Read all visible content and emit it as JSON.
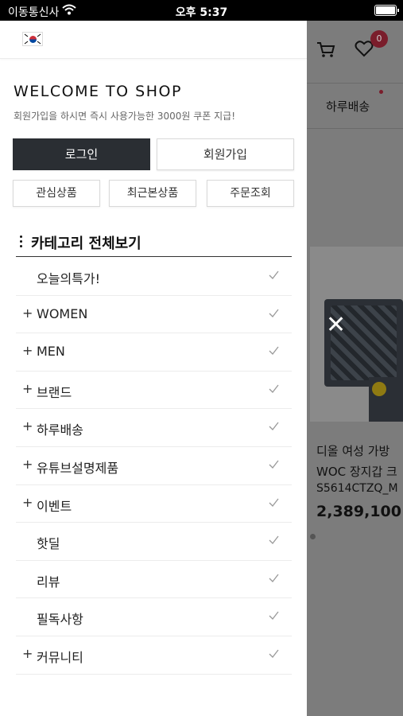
{
  "status_bar": {
    "carrier": "이동통신사",
    "time": "오후 5:37"
  },
  "background": {
    "cart_badge": "0",
    "nav_item": "하루배송",
    "product": {
      "title_line1": "디올 여성 가방",
      "title_line2": "WOC 장지갑 크",
      "code": "S5614CTZQ_M",
      "price": "2,389,100"
    },
    "close_symbol": "✕"
  },
  "drawer": {
    "welcome_title": "WELCOME TO SHOP",
    "welcome_subtitle": "회원가입을 하시면 즉시 사용가능한 3000원 쿠폰 지급!",
    "login_label": "로그인",
    "signup_label": "회원가입",
    "quick_links": [
      "관심상품",
      "최근본상품",
      "주문조회"
    ],
    "category_title": "카테고리 전체보기",
    "categories": [
      {
        "label": "오늘의특가!",
        "plus": ""
      },
      {
        "label": "WOMEN",
        "plus": "+"
      },
      {
        "label": "MEN",
        "plus": "+"
      },
      {
        "label": "브랜드",
        "plus": "+"
      },
      {
        "label": "하루배송",
        "plus": "+"
      },
      {
        "label": "유튜브설명제품",
        "plus": "+"
      },
      {
        "label": "이벤트",
        "plus": "+"
      },
      {
        "label": "핫딜",
        "plus": ""
      },
      {
        "label": "리뷰",
        "plus": ""
      },
      {
        "label": "필독사항",
        "plus": ""
      },
      {
        "label": "커뮤니티",
        "plus": "+"
      }
    ]
  },
  "colors": {
    "login_bg": "#2a2e33",
    "badge": "#c0324a"
  }
}
